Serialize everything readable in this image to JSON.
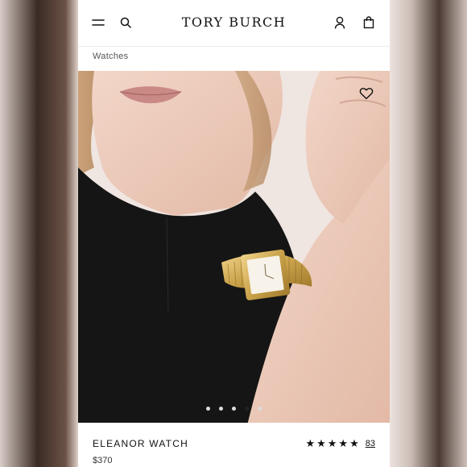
{
  "header": {
    "brand": "TORY BURCH",
    "menu_icon": "hamburger-menu-icon",
    "search_icon": "search-icon",
    "account_icon": "user-icon",
    "bag_icon": "shopping-bag-icon"
  },
  "breadcrumb": "Watches",
  "gallery": {
    "wishlist_icon": "heart-icon",
    "slide_count": 5,
    "active_slide": 4
  },
  "product": {
    "name": "ELEANOR WATCH",
    "price": "$370",
    "rating_stars": "★★★★★",
    "rating_value": 5,
    "review_count": "83"
  },
  "colors": {
    "text": "#111111",
    "dot_inactive": "#dcdcdc",
    "dot_active": "#222222",
    "gold": "#c9a24a"
  }
}
